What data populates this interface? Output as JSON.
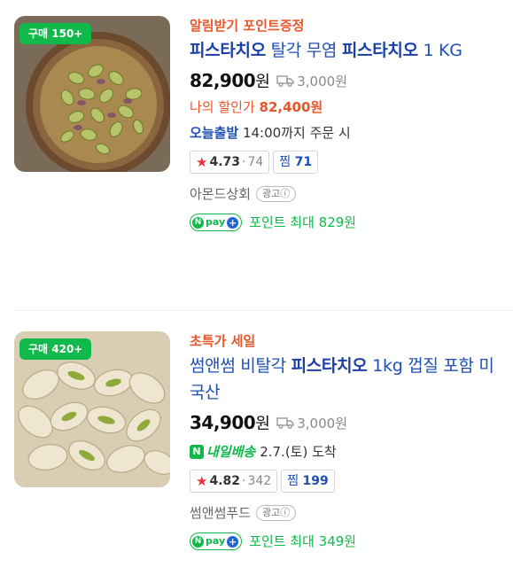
{
  "products": [
    {
      "badge": "구매 150+",
      "promo": "알림받기 포인트증정",
      "title_parts": {
        "p1": "피스타치오",
        "p2": " 탈각 무염 ",
        "p3": "피스타치오",
        "p4": " 1 KG"
      },
      "price": "82,900",
      "won": "원",
      "shipping": "3,000원",
      "my_discount_label": "나의 할인가 ",
      "my_discount_price": "82,400원",
      "delivery_label": "오늘출발",
      "delivery_text": " 14:00까지 주문 시",
      "rating": "4.73",
      "reviews": "74",
      "zzim_label": "찜",
      "zzim_count": "71",
      "seller": "아몬드상회",
      "ad_label": "광고ⓘ",
      "point_text": "포인트 최대 829원",
      "image_icon": "pistachio-bowl-image"
    },
    {
      "badge": "구매 420+",
      "promo": "초특가 세일",
      "title_parts": {
        "p1": "썸앤썸 비탈각 ",
        "p2": "피스타치오",
        "p3": " 1kg 껍질 포함 미국산"
      },
      "price": "34,900",
      "won": "원",
      "shipping": "3,000원",
      "delivery_n": "N",
      "delivery_label": "내일배송",
      "delivery_text": "2.7.(토) 도착",
      "rating": "4.82",
      "reviews": "342",
      "zzim_label": "찜",
      "zzim_count": "199",
      "seller": "썸앤썸푸드",
      "ad_label": "광고ⓘ",
      "point_text": "포인트 최대 349원",
      "image_icon": "pistachio-shell-image"
    }
  ],
  "npay": {
    "n": "N",
    "pay": "pay",
    "plus": "+"
  },
  "rating_star": "★",
  "rating_sep": "·",
  "colors": {
    "accent_blue": "#1e50b4",
    "promo_orange": "#e8562a",
    "naver_green": "#10b94a"
  }
}
